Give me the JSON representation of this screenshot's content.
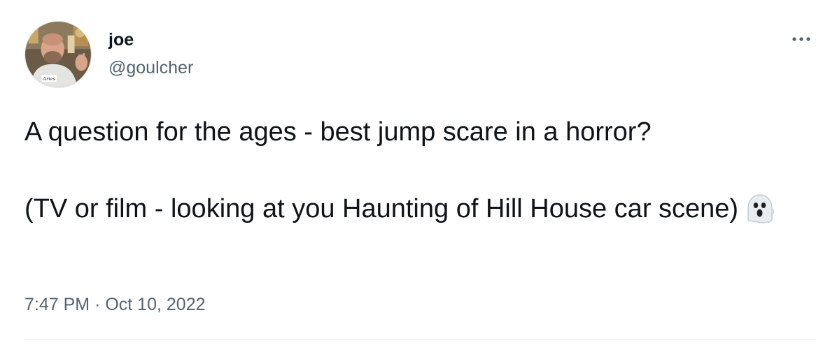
{
  "tweet": {
    "author": {
      "display_name": "joe",
      "handle": "@goulcher",
      "avatar_icon": "profile-photo",
      "avatar_badge_text": "Aries"
    },
    "more_icon": "ellipsis-icon",
    "text_line_1": "A question for the ages - best jump scare in a horror?",
    "text_line_2": "(TV or film - looking at you Haunting of Hill House car scene)",
    "emoji": "ghost",
    "time": "7:47 PM",
    "separator": "·",
    "date": "Oct 10, 2022"
  },
  "colors": {
    "text_primary": "#0f1419",
    "text_secondary": "#536471",
    "divider": "#eff3f4"
  }
}
